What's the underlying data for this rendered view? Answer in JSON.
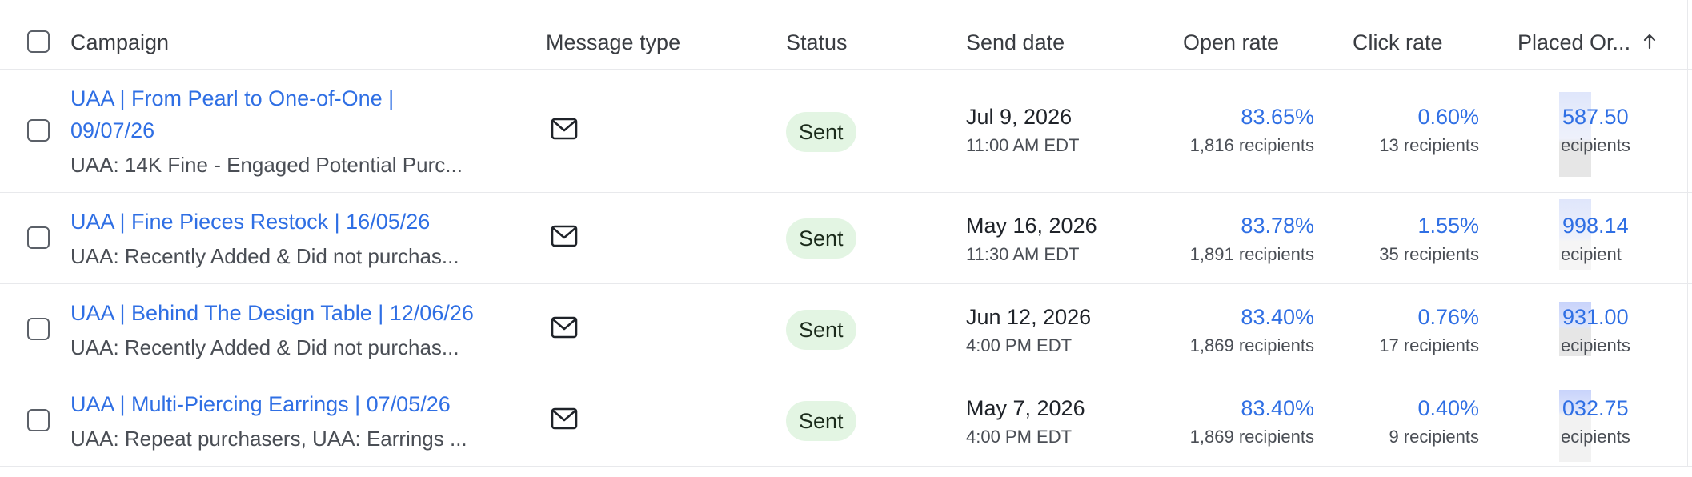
{
  "header": {
    "campaign": "Campaign",
    "message_type": "Message type",
    "status": "Status",
    "send_date": "Send date",
    "open_rate": "Open rate",
    "click_rate": "Click rate",
    "placed_orders": "Placed Or...",
    "sort_icon": "arrow-up-icon"
  },
  "rows": [
    {
      "title_line1": "UAA | From Pearl to One-of-One |",
      "title_line2": "09/07/26",
      "audience": "UAA: 14K Fine - Engaged Potential Purc...",
      "message_icon": "mail-icon",
      "status": "Sent",
      "date": "Jul 9, 2026",
      "time": "11:00 AM EDT",
      "open_rate": "83.65%",
      "open_recipients": "1,816 recipients",
      "click_rate": "0.60%",
      "click_recipients": "13 recipients",
      "placed_value": "587.50",
      "placed_recipients": "ecipients"
    },
    {
      "title_line1": "UAA | Fine Pieces Restock | 16/05/26",
      "title_line2": "",
      "audience": "UAA: Recently Added & Did not purchas...",
      "message_icon": "mail-icon",
      "status": "Sent",
      "date": "May 16, 2026",
      "time": "11:30 AM EDT",
      "open_rate": "83.78%",
      "open_recipients": "1,891 recipients",
      "click_rate": "1.55%",
      "click_recipients": "35 recipients",
      "placed_value": "998.14",
      "placed_recipients": "ecipient"
    },
    {
      "title_line1": "UAA | Behind The Design Table | 12/06/26",
      "title_line2": "",
      "audience": "UAA: Recently Added & Did not purchas...",
      "message_icon": "mail-icon",
      "status": "Sent",
      "date": "Jun 12, 2026",
      "time": "4:00 PM EDT",
      "open_rate": "83.40%",
      "open_recipients": "1,869 recipients",
      "click_rate": "0.76%",
      "click_recipients": "17 recipients",
      "placed_value": "931.00",
      "placed_recipients": "ecipients"
    },
    {
      "title_line1": "UAA | Multi-Piercing Earrings | 07/05/26",
      "title_line2": "",
      "audience": "UAA: Repeat purchasers, UAA: Earrings ...",
      "message_icon": "mail-icon",
      "status": "Sent",
      "date": "May 7, 2026",
      "time": "4:00 PM EDT",
      "open_rate": "83.40%",
      "open_recipients": "1,869 recipients",
      "click_rate": "0.40%",
      "click_recipients": "9 recipients",
      "placed_value": "032.75",
      "placed_recipients": "ecipients"
    }
  ],
  "colors": {
    "link": "#2f6fe4",
    "badge_bg": "#e3f5e3",
    "divider": "#e8e9ec"
  }
}
